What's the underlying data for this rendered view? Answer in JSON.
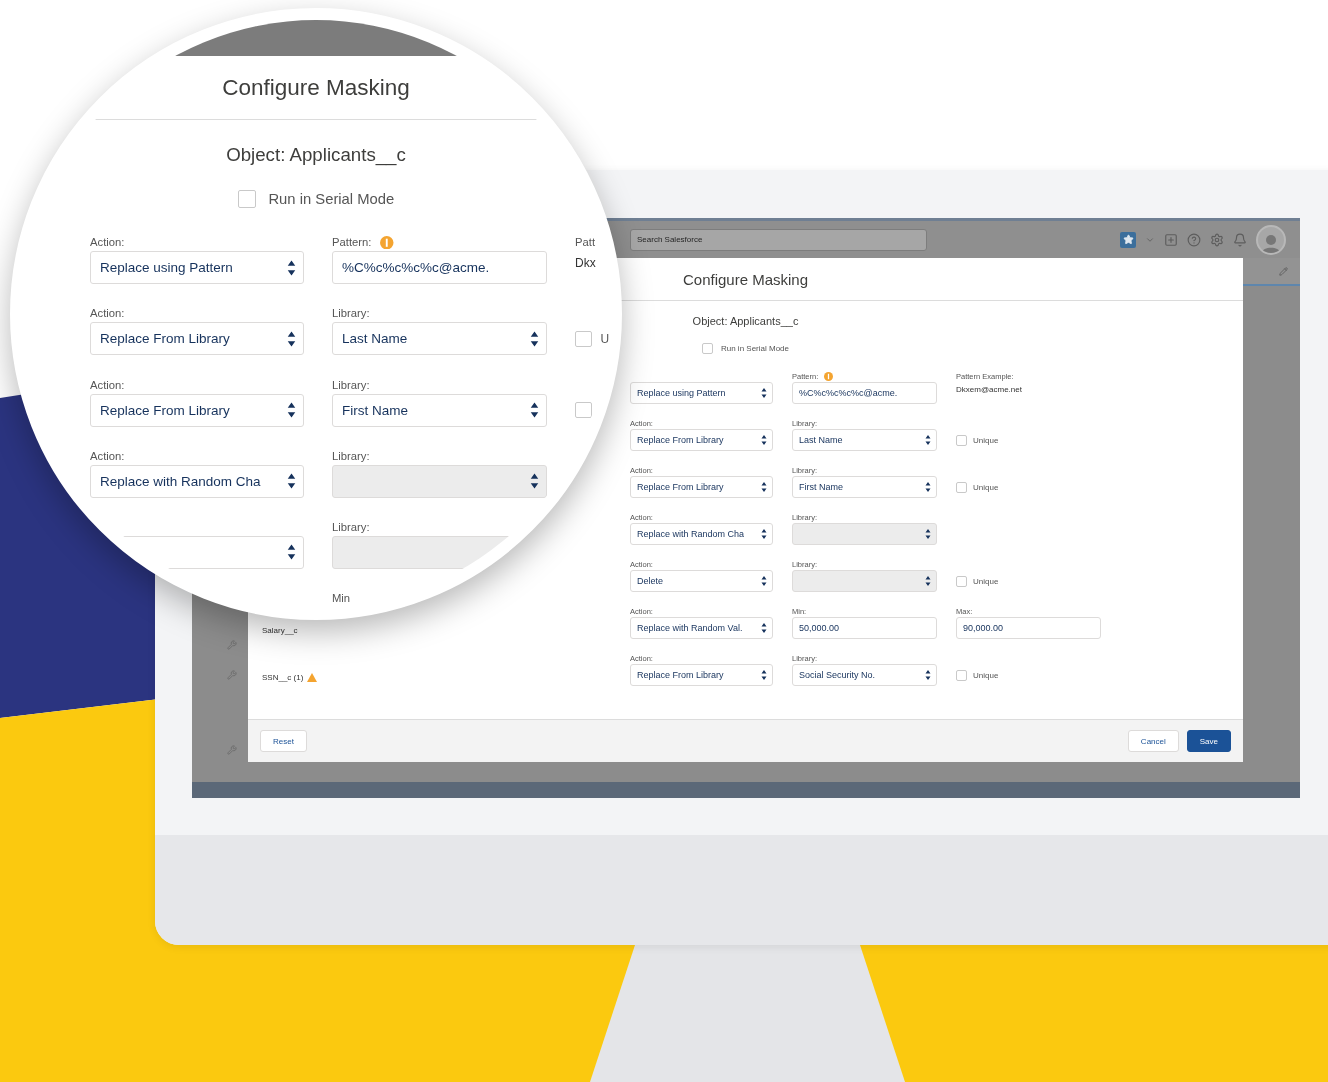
{
  "screen": {
    "search": {
      "placeholder": "Search Salesforce"
    },
    "modal": {
      "title": "Configure Masking",
      "object": "Object: Applicants__c",
      "serial_mode": {
        "label": "Run in Serial Mode",
        "checked": false
      },
      "rows": [
        {
          "action": {
            "value": "Replace using Pattern"
          },
          "second": {
            "kind": "input",
            "label": "Pattern:",
            "info": true,
            "value": "%C%c%c%c%c@acme."
          },
          "third": {
            "kind": "example",
            "label": "Pattern Example:",
            "value": "Dkxem@acme.net"
          }
        },
        {
          "action": {
            "label": "Action:",
            "value": "Replace From Library"
          },
          "second": {
            "kind": "select",
            "label": "Library:",
            "value": "Last Name"
          },
          "third": {
            "kind": "unique",
            "label": "Unique",
            "checked": false
          }
        },
        {
          "action": {
            "label": "Action:",
            "value": "Replace From Library"
          },
          "second": {
            "kind": "select",
            "label": "Library:",
            "value": "First Name"
          },
          "third": {
            "kind": "unique",
            "label": "Unique",
            "checked": false
          }
        },
        {
          "action": {
            "label": "Action:",
            "value": "Replace with Random Cha"
          },
          "second": {
            "kind": "disabled",
            "label": "Library:"
          }
        },
        {
          "action": {
            "label": "Action:",
            "value": "Delete"
          },
          "second": {
            "kind": "disabled",
            "label": "Library:"
          },
          "third": {
            "kind": "unique",
            "label": "Unique",
            "checked": false
          }
        },
        {
          "field": {
            "name": "Salary__c",
            "warning": false
          },
          "action": {
            "label": "Action:",
            "value": "Replace with Random Val."
          },
          "second": {
            "kind": "input",
            "label": "Min:",
            "value": "50,000.00"
          },
          "third": {
            "kind": "input",
            "label": "Max:",
            "value": "90,000.00"
          }
        },
        {
          "field": {
            "name": "SSN__c (1)",
            "warning": true
          },
          "action": {
            "label": "Action:",
            "value": "Replace From Library"
          },
          "second": {
            "kind": "select",
            "label": "Library:",
            "value": "Social Security No."
          },
          "third": {
            "kind": "unique",
            "label": "Unique",
            "checked": false
          }
        }
      ],
      "footer": {
        "reset": "Reset",
        "cancel": "Cancel",
        "save": "Save"
      }
    }
  },
  "magnifier": {
    "title": "Configure Masking",
    "object": "Object: Applicants__c",
    "serial_mode": {
      "label": "Run in Serial Mode",
      "checked": false
    },
    "rows": [
      {
        "action": {
          "label": "Action:",
          "value": "Replace using Pattern"
        },
        "second": {
          "kind": "input",
          "label": "Pattern:",
          "info": true,
          "value": "%C%c%c%c%c@acme."
        },
        "third": {
          "kind": "example",
          "label": "Patt",
          "value": "Dkx"
        }
      },
      {
        "action": {
          "label": "Action:",
          "value": "Replace From Library"
        },
        "second": {
          "kind": "select",
          "label": "Library:",
          "value": "Last Name"
        },
        "third": {
          "kind": "unique",
          "label": "U",
          "checked": false
        }
      },
      {
        "action": {
          "label": "Action:",
          "value": "Replace From Library"
        },
        "second": {
          "kind": "select",
          "label": "Library:",
          "value": "First Name"
        },
        "third": {
          "kind": "unique",
          "checked": false
        }
      },
      {
        "action": {
          "label": "Action:",
          "value": "Replace with Random Cha"
        },
        "second": {
          "kind": "disabled",
          "label": "Library:"
        }
      },
      {
        "action": {},
        "second": {
          "kind": "disabled",
          "label": "Library:",
          "cut": true
        }
      },
      {
        "second": {
          "kind": "label",
          "label": "Min"
        }
      }
    ]
  }
}
